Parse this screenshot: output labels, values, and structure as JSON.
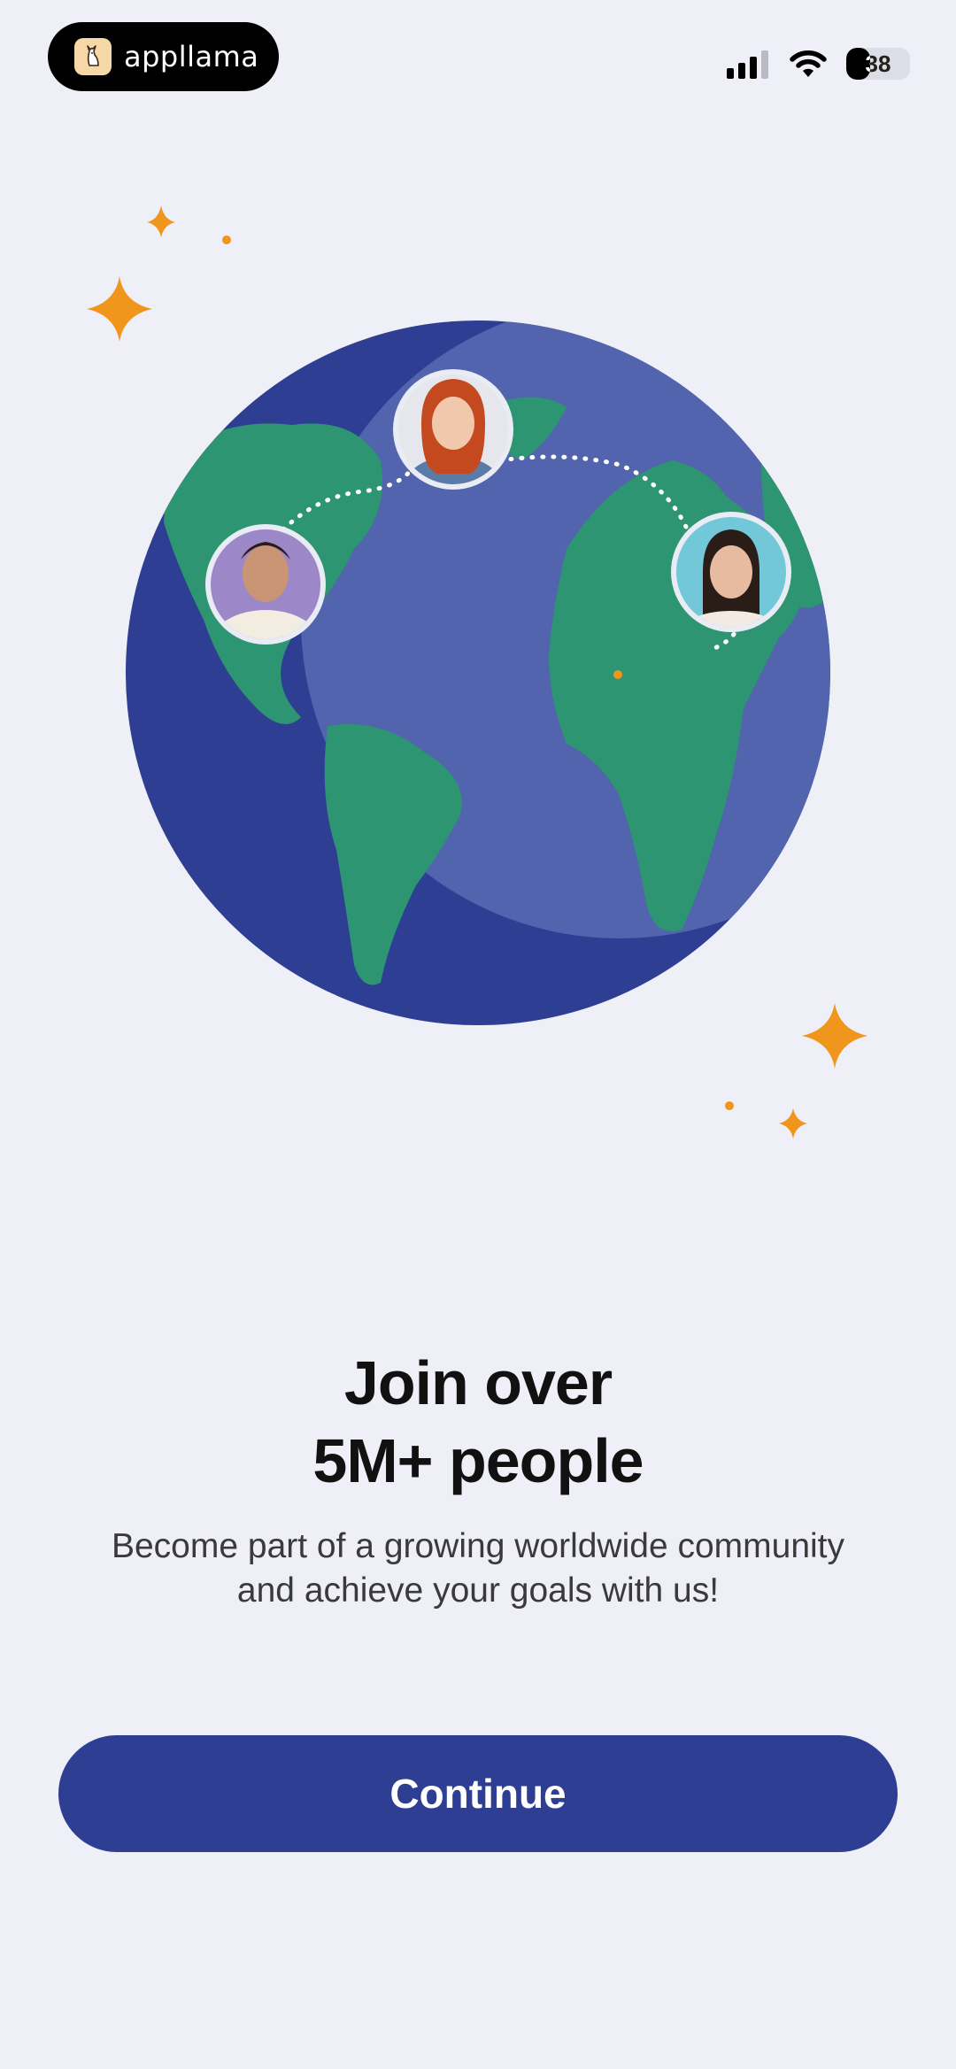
{
  "status_bar": {
    "app_name": "appllama",
    "battery_level": "38",
    "battery_fraction": 0.38,
    "signal_bars": 4,
    "signal_active": 3
  },
  "illustration": {
    "icons": [
      "sparkle-icon",
      "globe-icon",
      "avatar",
      "dotted-route"
    ],
    "colors": {
      "ocean": "#2e3e93",
      "ocean_light": "#5164ad",
      "land": "#2d9571",
      "sparkle": "#f0961c"
    }
  },
  "content": {
    "headline_line1": "Join over",
    "headline_line2": "5M+ people",
    "subtitle_line1": "Become part of a growing worldwide community",
    "subtitle_line2": "and achieve your goals with us!"
  },
  "actions": {
    "continue_label": "Continue"
  },
  "theme": {
    "background": "#eeeff7",
    "primary": "#2e3e93",
    "text": "#111111"
  }
}
